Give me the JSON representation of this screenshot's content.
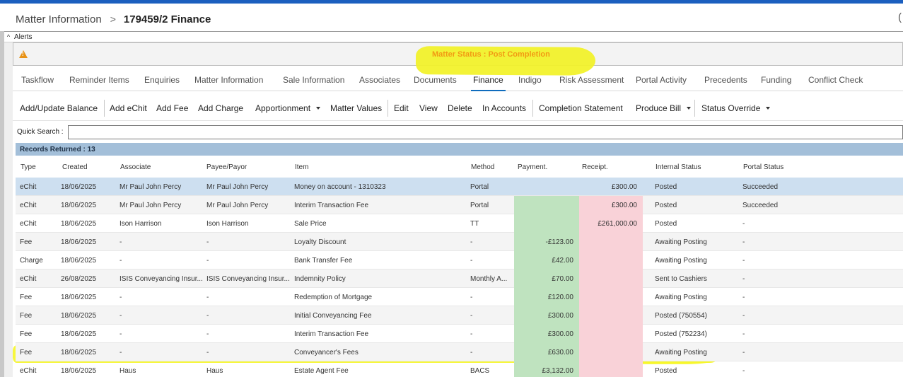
{
  "header": {
    "breadcrumb_root": "Matter Information",
    "breadcrumb_sep": ">",
    "breadcrumb_current": "179459/2 Finance",
    "paren_glyph": "("
  },
  "alerts": {
    "collapse_glyph": "^",
    "label": "Alerts",
    "message": "Matter Status : Post Completion"
  },
  "tabs": [
    {
      "label": "Taskflow"
    },
    {
      "label": "Reminder Items"
    },
    {
      "label": "Enquiries"
    },
    {
      "label": "Matter Information"
    },
    {
      "label": "Sale Information"
    },
    {
      "label": "Associates"
    },
    {
      "label": "Documents"
    },
    {
      "label": "Finance",
      "active": true
    },
    {
      "label": "Indigo"
    },
    {
      "label": "Risk Assessment"
    },
    {
      "label": "Portal Activity"
    },
    {
      "label": "Precedents"
    },
    {
      "label": "Funding"
    },
    {
      "label": "Conflict Check"
    }
  ],
  "toolbar": {
    "add_update_balance": "Add/Update Balance",
    "add_echit": "Add eChit",
    "add_fee": "Add Fee",
    "add_charge": "Add Charge",
    "apportionment": "Apportionment",
    "matter_values": "Matter Values",
    "edit": "Edit",
    "view": "View",
    "delete": "Delete",
    "in_accounts": "In Accounts",
    "completion_statement": "Completion Statement",
    "produce_bill": "Produce Bill",
    "status_override": "Status Override"
  },
  "quick_search": {
    "label": "Quick Search :",
    "value": ""
  },
  "records": {
    "label": "Records Returned : 13"
  },
  "table": {
    "columns": [
      "Type",
      "Created",
      "Associate",
      "Payee/Payor",
      "Item",
      "Method",
      "Payment.",
      "Receipt.",
      "Internal Status",
      "Portal Status"
    ],
    "rows": [
      {
        "type": "eChit",
        "created": "18/06/2025",
        "associate": "Mr Paul John Percy",
        "payee": "Mr Paul John Percy",
        "item": "Money on account - 1310323",
        "method": "Portal",
        "payment": "",
        "receipt": "£300.00",
        "internal_status": "Posted",
        "portal_status": "Succeeded"
      },
      {
        "type": "eChit",
        "created": "18/06/2025",
        "associate": "Mr Paul John Percy",
        "payee": "Mr Paul John Percy",
        "item": "Interim Transaction Fee",
        "method": "Portal",
        "payment": "",
        "receipt": "£300.00",
        "internal_status": "Posted",
        "portal_status": "Succeeded"
      },
      {
        "type": "eChit",
        "created": "18/06/2025",
        "associate": "Ison Harrison",
        "payee": "Ison Harrison",
        "item": "Sale Price",
        "method": "TT",
        "payment": "",
        "receipt": "£261,000.00",
        "internal_status": "Posted",
        "portal_status": "-"
      },
      {
        "type": "Fee",
        "created": "18/06/2025",
        "associate": "-",
        "payee": "-",
        "item": "Loyalty Discount",
        "method": "-",
        "payment": "-£123.00",
        "receipt": "",
        "internal_status": "Awaiting Posting",
        "portal_status": "-"
      },
      {
        "type": "Charge",
        "created": "18/06/2025",
        "associate": "-",
        "payee": "-",
        "item": "Bank Transfer Fee",
        "method": "-",
        "payment": "£42.00",
        "receipt": "",
        "internal_status": "Awaiting Posting",
        "portal_status": "-"
      },
      {
        "type": "eChit",
        "created": "26/08/2025",
        "associate": "ISIS Conveyancing Insur...",
        "payee": "ISIS Conveyancing Insur...",
        "item": "Indemnity Policy",
        "method": "Monthly A...",
        "payment": "£70.00",
        "receipt": "",
        "internal_status": "Sent to Cashiers",
        "portal_status": "-"
      },
      {
        "type": "Fee",
        "created": "18/06/2025",
        "associate": "-",
        "payee": "-",
        "item": "Redemption of Mortgage",
        "method": "-",
        "payment": "£120.00",
        "receipt": "",
        "internal_status": "Awaiting Posting",
        "portal_status": "-"
      },
      {
        "type": "Fee",
        "created": "18/06/2025",
        "associate": "-",
        "payee": "-",
        "item": "Initial Conveyancing Fee",
        "method": "-",
        "payment": "£300.00",
        "receipt": "",
        "internal_status": "Posted (750554)",
        "portal_status": "-"
      },
      {
        "type": "Fee",
        "created": "18/06/2025",
        "associate": "-",
        "payee": "-",
        "item": "Interim Transaction Fee",
        "method": "-",
        "payment": "£300.00",
        "receipt": "",
        "internal_status": "Posted (752234)",
        "portal_status": "-"
      },
      {
        "type": "Fee",
        "created": "18/06/2025",
        "associate": "-",
        "payee": "-",
        "item": "Conveyancer's Fees",
        "method": "-",
        "payment": "£630.00",
        "receipt": "",
        "internal_status": "Awaiting Posting",
        "portal_status": "-"
      },
      {
        "type": "eChit",
        "created": "18/06/2025",
        "associate": "Haus",
        "payee": "Haus",
        "item": "Estate Agent Fee",
        "method": "BACS",
        "payment": "£3,132.00",
        "receipt": "",
        "internal_status": "Posted",
        "portal_status": "-"
      }
    ]
  },
  "colors": {
    "accent": "#1b5fbf",
    "tab_active_underline": "#0f6cbd",
    "warning": "#f29a13",
    "highlighter": "#f6f628",
    "payment_cell": "#bfe3bf",
    "receipt_cell": "#f9d2d8",
    "selected_row": "#cddff0",
    "records_bar": "#a3bfd9"
  }
}
